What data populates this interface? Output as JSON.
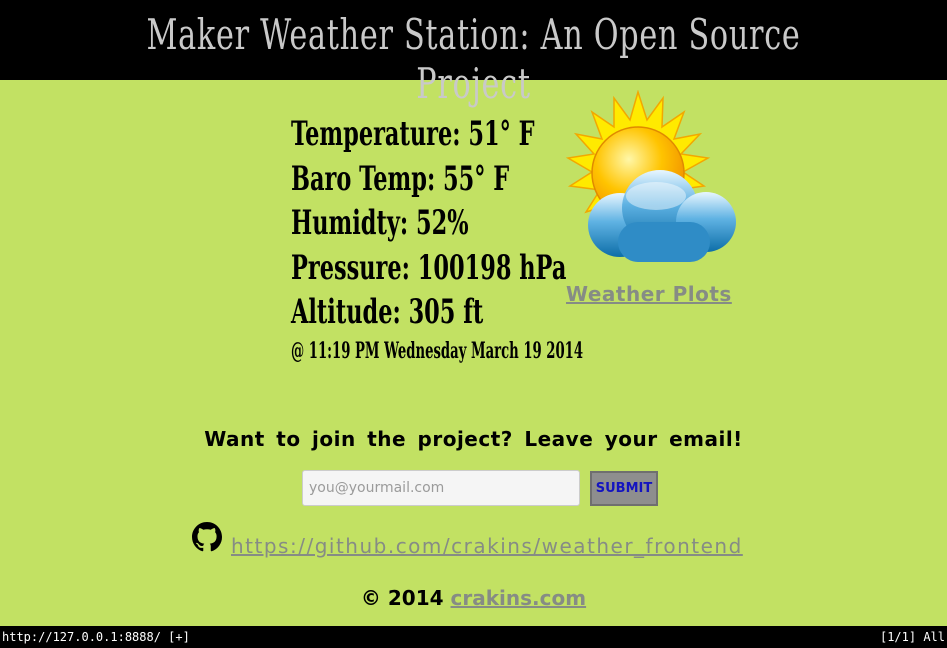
{
  "header": {
    "title": "Maker Weather Station: An Open Source Project"
  },
  "readings": {
    "temperature": "Temperature: 51° F",
    "baro_temp": "Baro Temp: 55° F",
    "humidity": "Humidty: 52%",
    "pressure": "Pressure: 100198 hPa",
    "altitude": "Altitude: 305 ft",
    "timestamp": "@ 11:19 PM Wednesday March 19 2014"
  },
  "weather_plots_link": "Weather Plots",
  "signup": {
    "prompt": "Want to join the project? Leave your email!",
    "email_placeholder": "you@yourmail.com",
    "submit_label": "SUBMIT"
  },
  "github": {
    "url_text": "https://github.com/crakins/weather_frontend"
  },
  "footer": {
    "copyright": "©  2014",
    "site_link": "crakins.com"
  },
  "statusbar": {
    "url": "http://127.0.0.1:8888/ [+]",
    "position": "[1/1] All"
  },
  "icons": {
    "weather": "sun-behind-cloud-icon",
    "github": "github-icon"
  }
}
